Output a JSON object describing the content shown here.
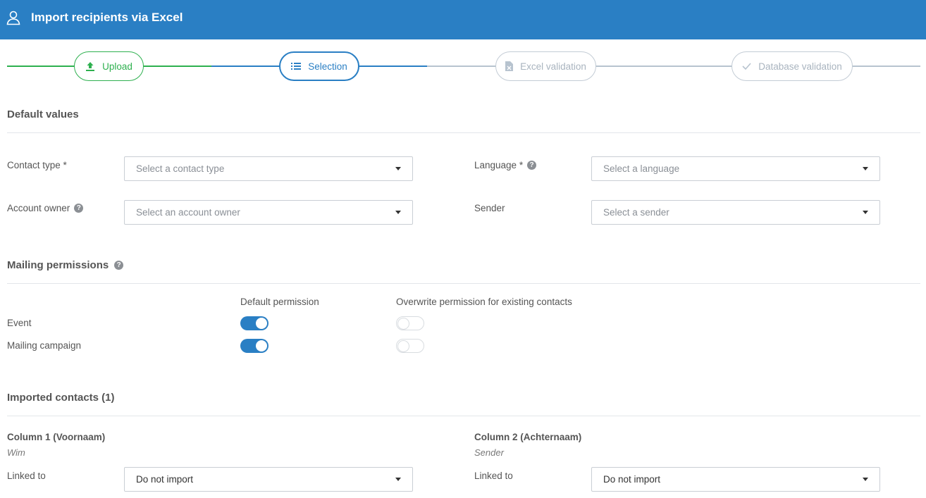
{
  "header": {
    "title": "Import recipients via Excel",
    "icon": "user-icon"
  },
  "steps": [
    {
      "label": "Upload",
      "icon": "upload-icon",
      "state": "done",
      "color": "#2eb04f"
    },
    {
      "label": "Selection",
      "icon": "list-icon",
      "state": "active",
      "color": "#2a7fc4"
    },
    {
      "label": "Excel validation",
      "icon": "excel-file-icon",
      "state": "pending",
      "color": "#b7c3cf"
    },
    {
      "label": "Database validation",
      "icon": "check-icon",
      "state": "pending",
      "color": "#b7c3cf"
    }
  ],
  "default_values": {
    "title": "Default values",
    "contact_type": {
      "label": "Contact type *",
      "placeholder": "Select a contact type"
    },
    "language": {
      "label": "Language *",
      "placeholder": "Select a language"
    },
    "account_owner": {
      "label": "Account owner",
      "placeholder": "Select an account owner"
    },
    "sender": {
      "label": "Sender",
      "placeholder": "Select a sender"
    }
  },
  "mailing_permissions": {
    "title": "Mailing permissions",
    "col_default": "Default permission",
    "col_overwrite": "Overwrite permission for existing contacts",
    "rows": [
      {
        "label": "Event",
        "default_on": true,
        "overwrite_on": false
      },
      {
        "label": "Mailing campaign",
        "default_on": true,
        "overwrite_on": false
      }
    ]
  },
  "imported_contacts": {
    "title": "Imported contacts (1)",
    "columns": [
      {
        "title": "Column 1 (Voornaam)",
        "sample": "Wim",
        "linked_label": "Linked to",
        "linked_value": "Do not import"
      },
      {
        "title": "Column 2 (Achternaam)",
        "sample": "Sender",
        "linked_label": "Linked to",
        "linked_value": "Do not import"
      }
    ]
  },
  "colors": {
    "header": "#2a7fc4",
    "done": "#2eb04f",
    "active": "#2a7fc4",
    "pending": "#b7c3cf"
  }
}
